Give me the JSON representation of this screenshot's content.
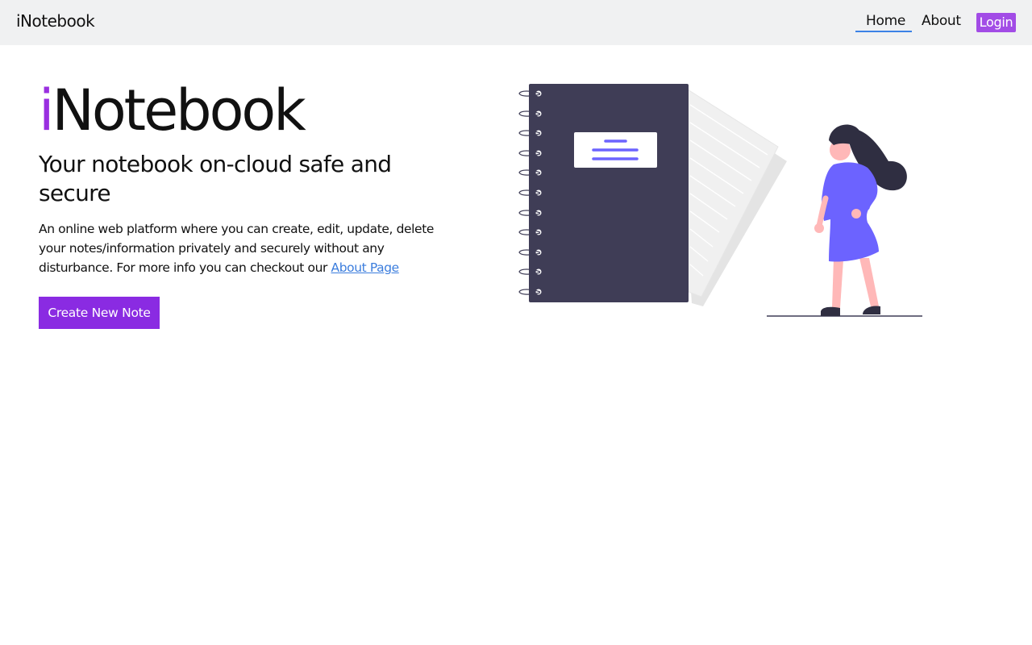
{
  "navbar": {
    "brand": "iNotebook",
    "links": [
      {
        "label": "Home",
        "active": true
      },
      {
        "label": "About",
        "active": false
      }
    ],
    "login_label": "Login"
  },
  "hero": {
    "title_accent": "i",
    "title_rest": "Notebook",
    "subtitle": "Your notebook on-cloud safe and secure",
    "description_text": "An online web platform where you can create, edit, update, delete your notes/information privately and securely without any disturbance. For more info you can checkout our ",
    "description_link": "About Page",
    "cta_label": "Create New Note"
  },
  "illustration": {
    "icon": "notebook-woman-illustration"
  },
  "colors": {
    "accent": "#9a2fe0",
    "button": "#8a2be2",
    "login_button": "#a24ce6",
    "link": "#3b7ddd",
    "notebook": "#3f3d56",
    "figure": "#6c63ff"
  }
}
